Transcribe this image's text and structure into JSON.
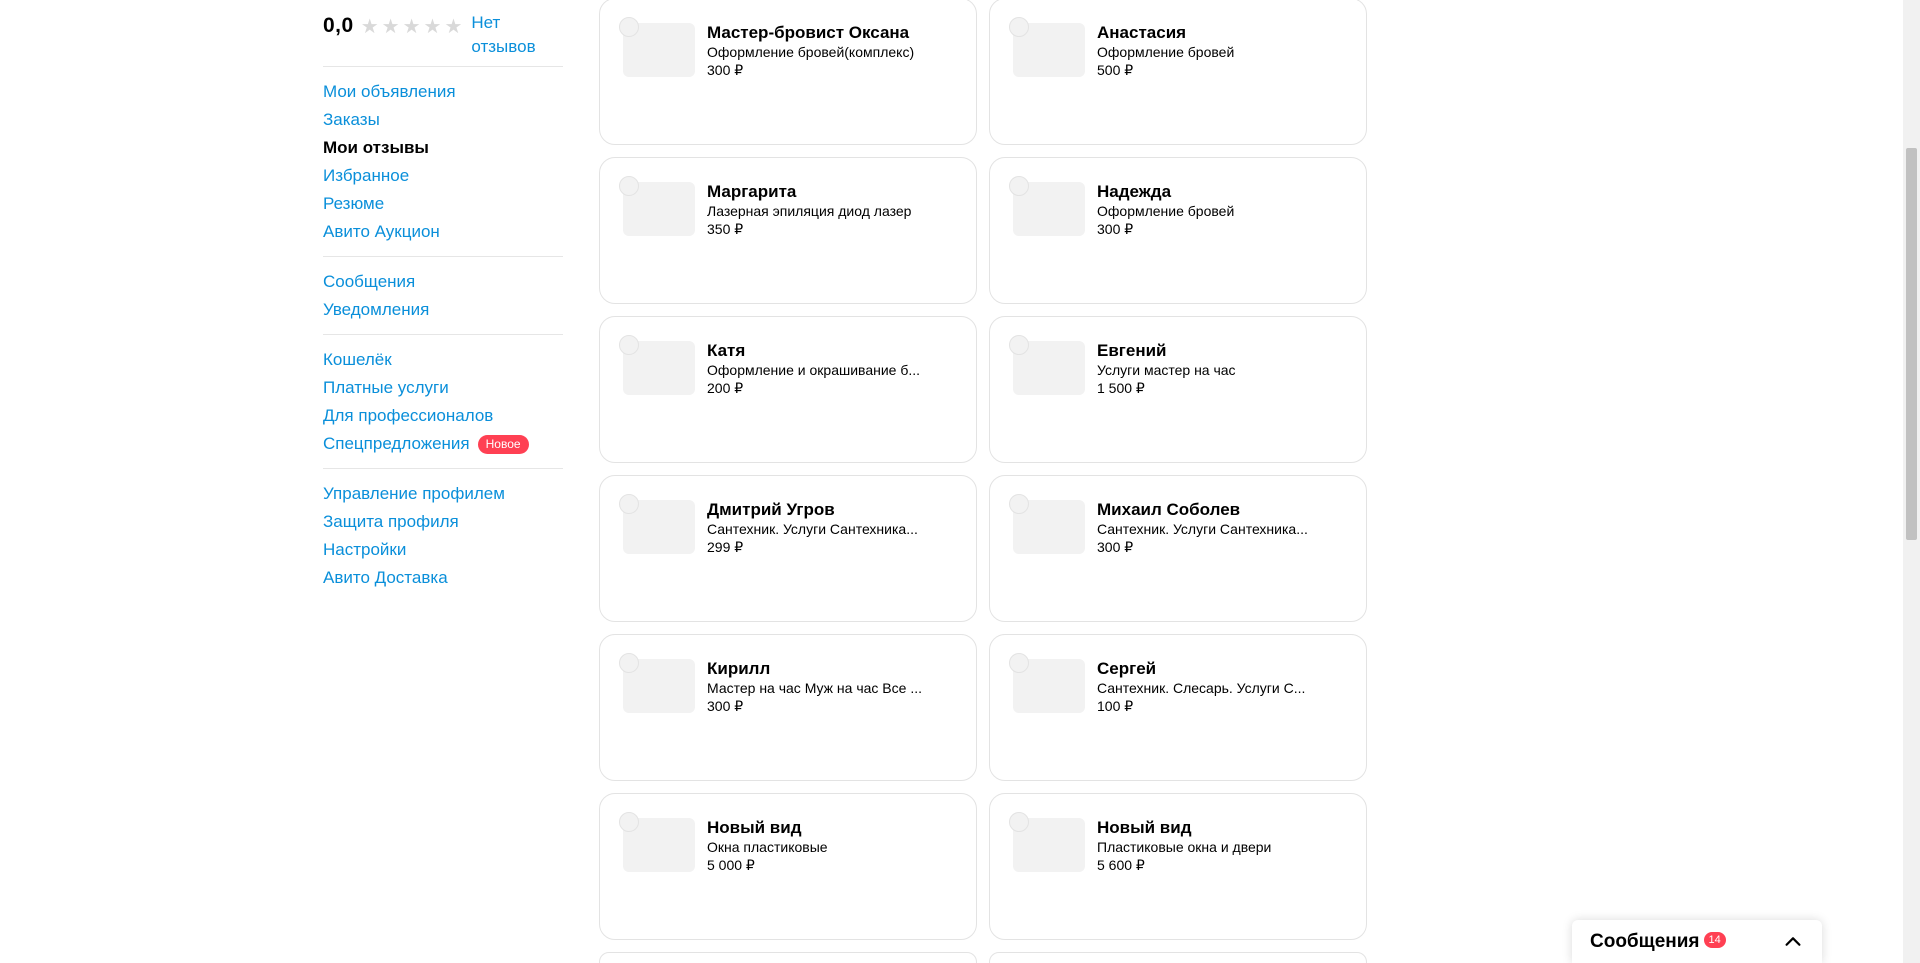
{
  "sidebar": {
    "rating_value": "0,0",
    "stars_filled": 0,
    "stars_total": 5,
    "no_reviews_label": "Нет отзывов",
    "groups": [
      {
        "items": [
          {
            "label": "Мои объявления",
            "active": false
          },
          {
            "label": "Заказы",
            "active": false
          },
          {
            "label": "Мои отзывы",
            "active": true
          },
          {
            "label": "Избранное",
            "active": false
          },
          {
            "label": "Резюме",
            "active": false
          },
          {
            "label": "Авито Аукцион",
            "active": false
          }
        ]
      },
      {
        "items": [
          {
            "label": "Сообщения",
            "active": false
          },
          {
            "label": "Уведомления",
            "active": false
          }
        ]
      },
      {
        "items": [
          {
            "label": "Кошелёк",
            "active": false
          },
          {
            "label": "Платные услуги",
            "active": false
          },
          {
            "label": "Для профессионалов",
            "active": false
          },
          {
            "label": "Спецпредложения",
            "active": false,
            "badge": "Новое"
          }
        ]
      },
      {
        "items": [
          {
            "label": "Управление профилем",
            "active": false
          },
          {
            "label": "Защита профиля",
            "active": false
          },
          {
            "label": "Настройки",
            "active": false
          },
          {
            "label": "Авито Доставка",
            "active": false
          }
        ]
      }
    ]
  },
  "cards": [
    {
      "name": "Мастер-бровист Оксана",
      "service": "Оформление бровей(комплекс)",
      "price": "300 ₽"
    },
    {
      "name": "Анастасия",
      "service": "Оформление бровей",
      "price": "500 ₽"
    },
    {
      "name": "Маргарита",
      "service": "Лазерная эпиляция диод лазер",
      "price": "350 ₽"
    },
    {
      "name": "Надежда",
      "service": "Оформление бровей",
      "price": "300 ₽"
    },
    {
      "name": "Катя",
      "service": "Оформление и окрашивание б...",
      "price": "200 ₽"
    },
    {
      "name": "Евгений",
      "service": "Услуги мастер на час",
      "price": "1 500 ₽"
    },
    {
      "name": "Дмитрий Угров",
      "service": "Сантехник. Услуги Сантехника...",
      "price": "299 ₽"
    },
    {
      "name": "Михаил Соболев",
      "service": "Сантехник. Услуги Сантехника...",
      "price": "300 ₽"
    },
    {
      "name": "Кирилл",
      "service": "Мастер на час Муж на час Все ...",
      "price": "300 ₽"
    },
    {
      "name": "Сергей",
      "service": "Сантехник. Слесарь. Услуги С...",
      "price": "100 ₽"
    },
    {
      "name": "Новый вид",
      "service": "Окна пластиковые",
      "price": "5 000 ₽"
    },
    {
      "name": "Новый вид",
      "service": "Пластиковые окна и двери",
      "price": "5 600 ₽"
    }
  ],
  "messenger": {
    "title": "Сообщения",
    "count": "14",
    "chevron_icon": "chevron-up-icon"
  },
  "colors": {
    "link": "#0a8fda",
    "badge": "#ff4053",
    "star_empty": "#d9d9d9"
  }
}
